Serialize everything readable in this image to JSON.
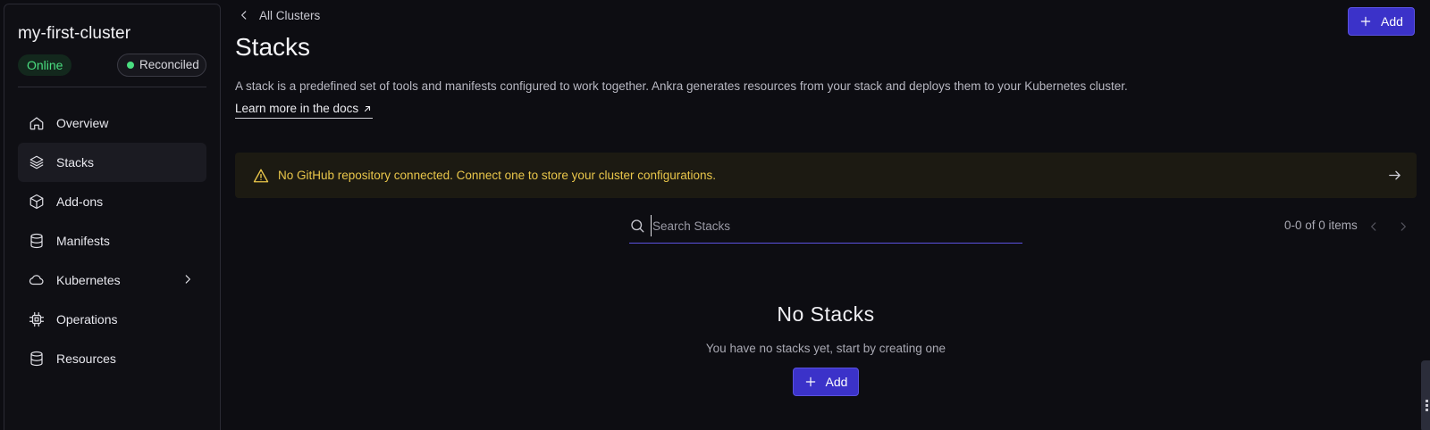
{
  "sidebar": {
    "cluster_name": "my-first-cluster",
    "status_badge": "Online",
    "reconcile_badge": "Reconciled",
    "items": [
      {
        "label": "Overview",
        "icon": "home-icon"
      },
      {
        "label": "Stacks",
        "icon": "layers-icon",
        "active": true
      },
      {
        "label": "Add-ons",
        "icon": "cube-icon"
      },
      {
        "label": "Manifests",
        "icon": "database-icon"
      },
      {
        "label": "Kubernetes",
        "icon": "cloud-icon",
        "expandable": true
      },
      {
        "label": "Operations",
        "icon": "cpu-chip-icon"
      },
      {
        "label": "Resources",
        "icon": "database-icon"
      }
    ]
  },
  "header": {
    "back_label": "All Clusters",
    "title": "Stacks",
    "add_label": "Add"
  },
  "content": {
    "description": "A stack is a predefined set of tools and manifests configured to work together. Ankra generates resources from your stack and deploys them to your Kubernetes cluster.",
    "docs_link": "Learn more in the docs"
  },
  "warning": {
    "text": "No GitHub repository connected. Connect one to store your cluster configurations."
  },
  "search": {
    "placeholder": "Search Stacks",
    "value": ""
  },
  "pagination": {
    "summary": "0-0 of 0 items"
  },
  "empty_state": {
    "title": "No Stacks",
    "subtitle": "You have no stacks yet, start by creating one",
    "add_label": "Add"
  },
  "colors": {
    "accent": "#3b32c9",
    "online": "#4ade80",
    "warning_text": "#e9c64a",
    "background": "#0d0d12"
  }
}
